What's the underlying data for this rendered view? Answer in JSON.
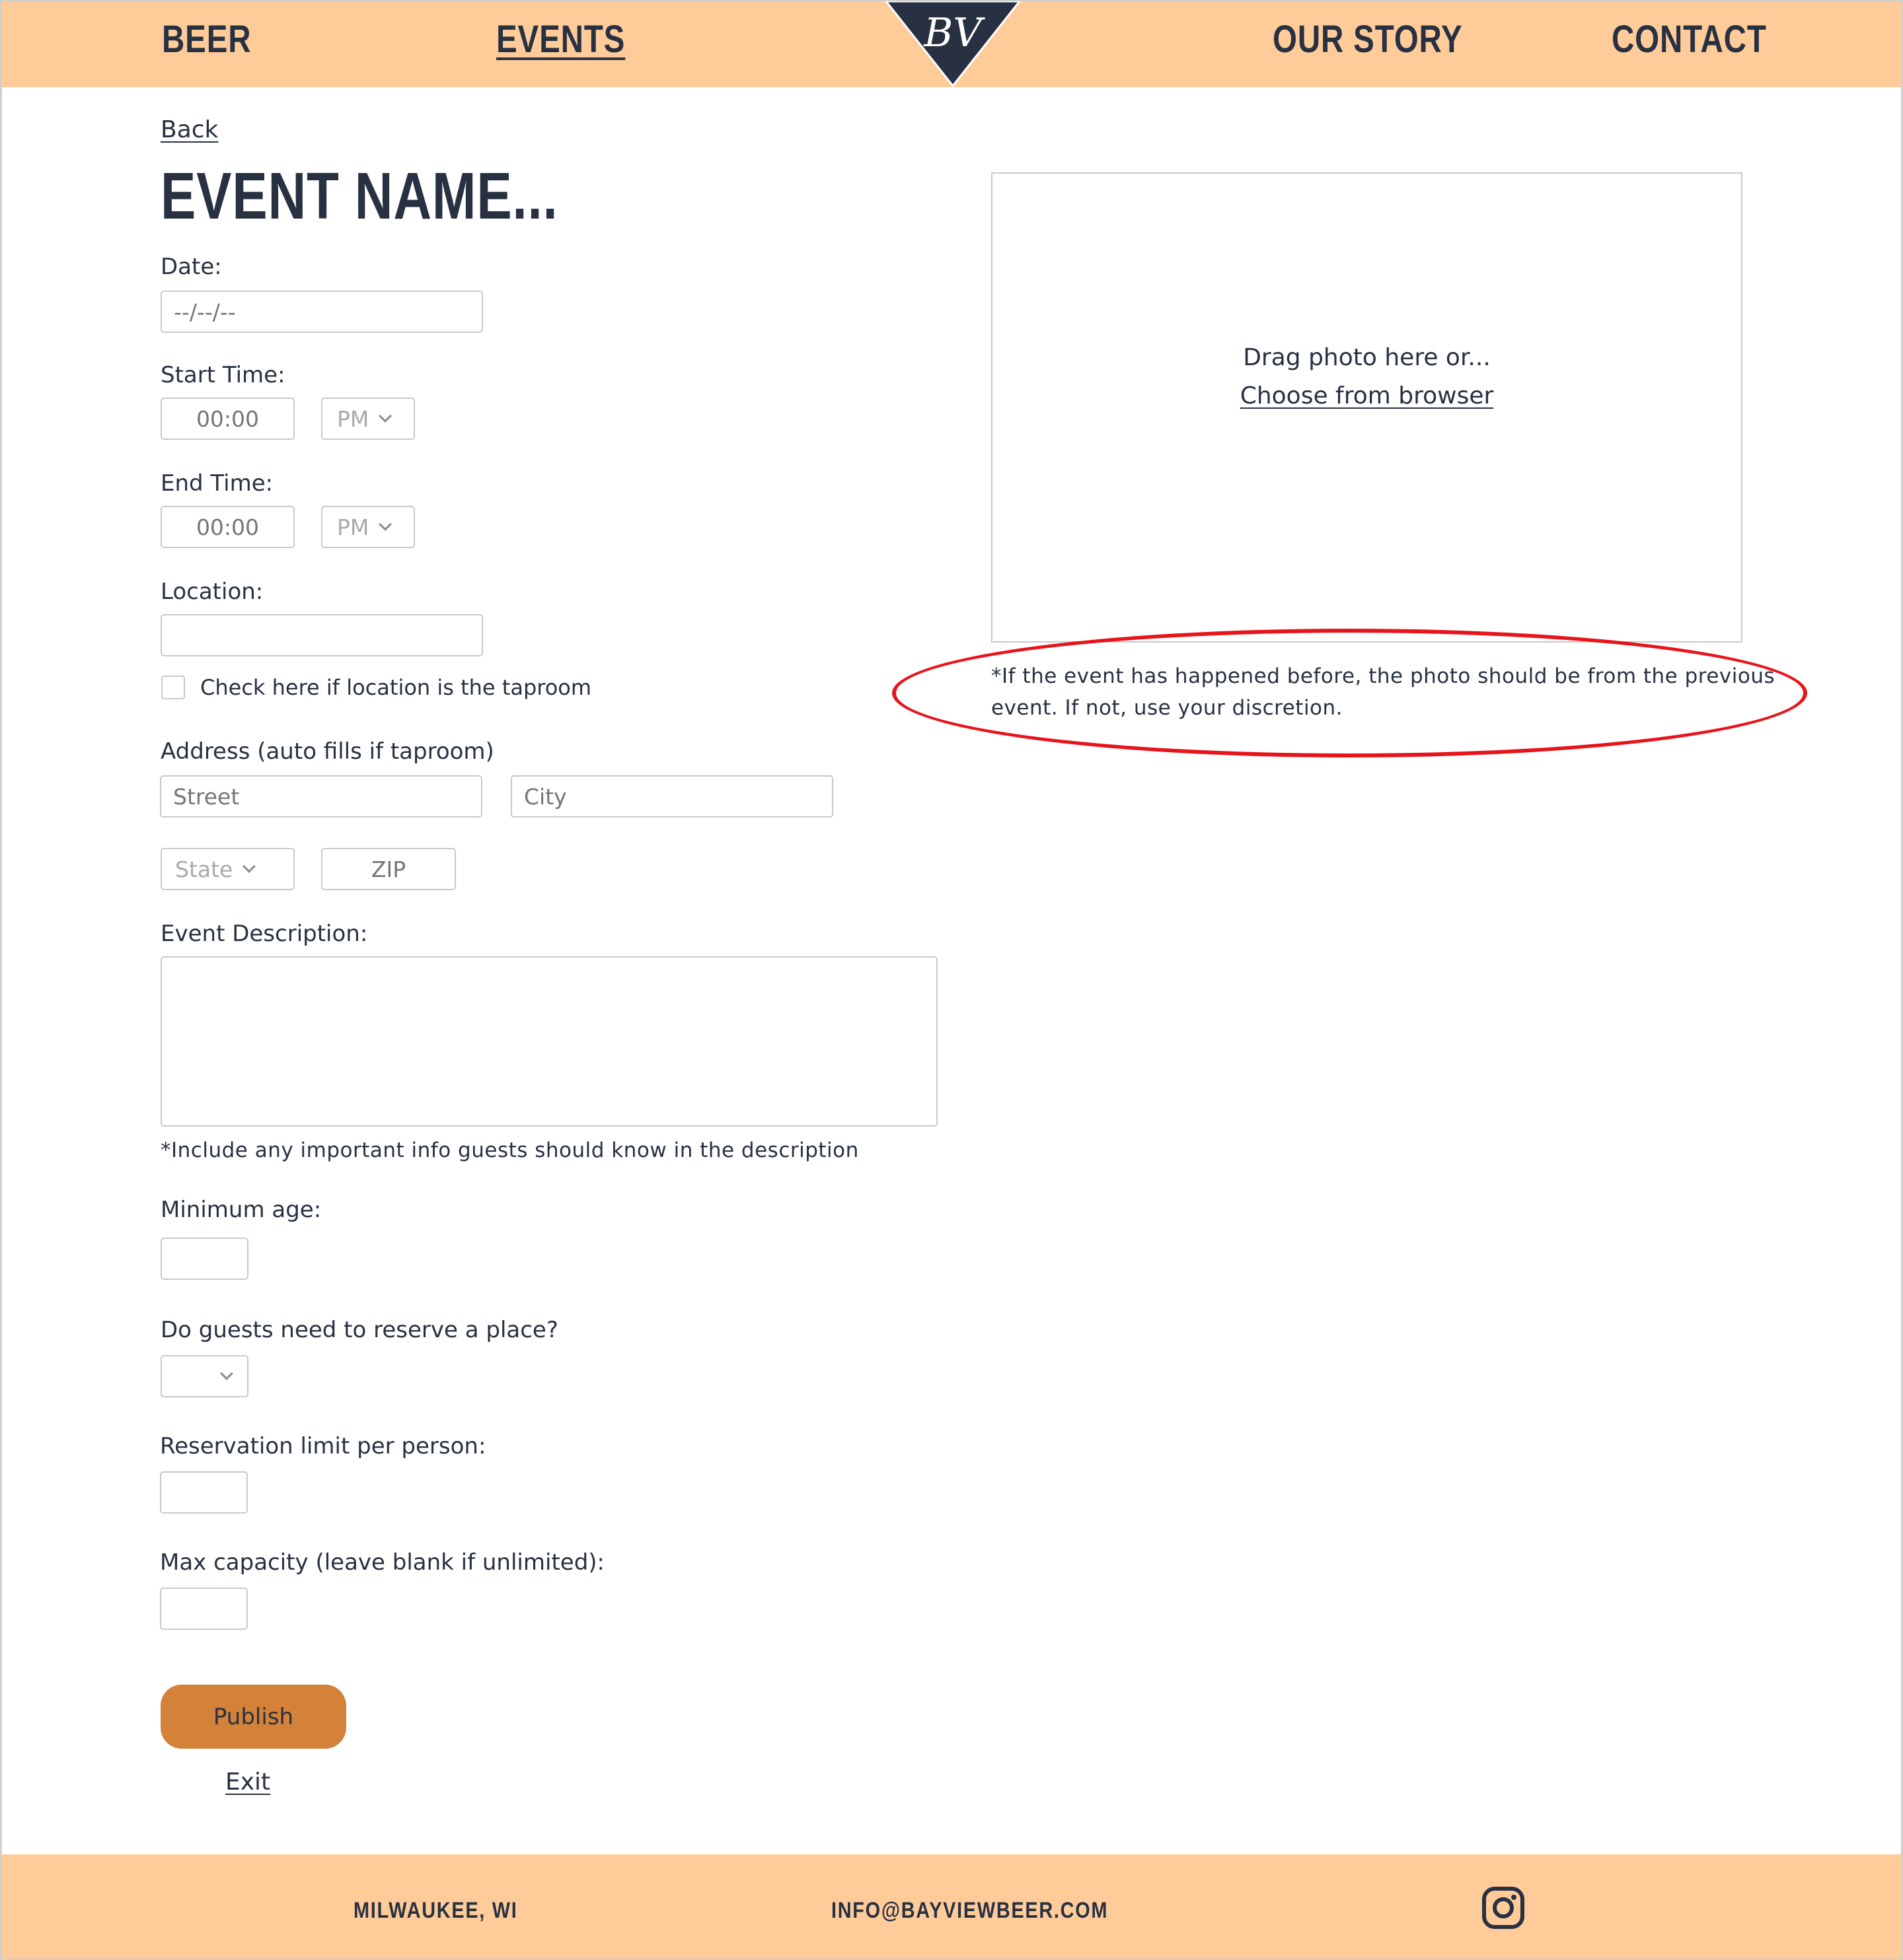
{
  "header": {
    "nav": [
      "BEER",
      "EVENTS",
      "OUR STORY",
      "CONTACT"
    ],
    "active": "EVENTS",
    "logo_text": "BV"
  },
  "form": {
    "back_link": "Back",
    "title": "EVENT NAME...",
    "date_label": "Date:",
    "date_placeholder": "--/--/--",
    "start_time_label": "Start Time:",
    "start_time_placeholder": "00:00",
    "start_ampm": "PM",
    "end_time_label": "End Time:",
    "end_time_placeholder": "00:00",
    "end_ampm": "PM",
    "location_label": "Location:",
    "location_value": "",
    "taproom_checkbox_label": "Check here if location is the taproom",
    "taproom_checked": false,
    "address_label": "Address (auto fills if taproom)",
    "street_placeholder": "Street",
    "city_placeholder": "City",
    "state_placeholder": "State",
    "zip_placeholder": "ZIP",
    "description_label": "Event Description:",
    "description_value": "",
    "description_note": "*Include any important info guests should know in the description",
    "min_age_label": "Minimum age:",
    "reserve_label": "Do guests need to reserve a place?",
    "reserve_value": "",
    "reservation_limit_label": "Reservation limit per person:",
    "max_capacity_label": "Max capacity (leave blank if unlimited):",
    "publish_label": "Publish",
    "exit_label": "Exit"
  },
  "photo": {
    "drag_text": "Drag photo here or...",
    "choose_link": "Choose from browser",
    "note_line1": "*If the event has happened before, the photo should be from the previous",
    "note_line2": "event.  If not, use your discretion.",
    "annotation_color": "#e8141b"
  },
  "footer": {
    "location": "MILWAUKEE, WI",
    "email": "INFO@BAYVIEWBEER.COM",
    "social_icon": "instagram-icon"
  },
  "colors": {
    "header_bg": "#ffcc99",
    "text_navy": "#283142",
    "publish_bg": "#d4813a"
  }
}
